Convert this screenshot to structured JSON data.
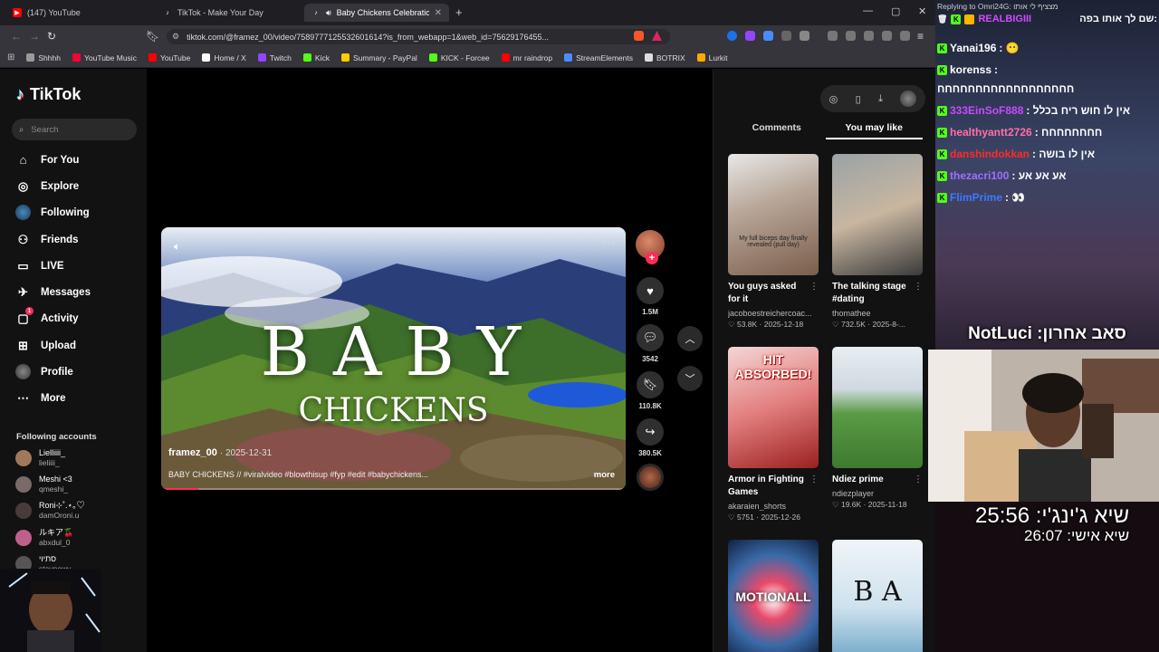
{
  "tabs": [
    {
      "title": "(147) YouTube",
      "favicon": "youtube-icon",
      "color": "#ff0000"
    },
    {
      "title": "TikTok - Make Your Day",
      "favicon": "tiktok-icon",
      "color": "#ffffff"
    },
    {
      "title": "Baby Chickens Celebration fo",
      "favicon": "tiktok-icon",
      "color": "#ffffff",
      "active": true
    }
  ],
  "address": {
    "url": "tiktok.com/@framez_00/video/7589777125532601614?is_from_webapp=1&web_id=75629176455..."
  },
  "bookmarks": [
    {
      "label": "Shhhh",
      "icon": "folder-icon",
      "color": "#999999"
    },
    {
      "label": "YouTube Music",
      "icon": "youtube-music-icon",
      "color": "#ff0033"
    },
    {
      "label": "YouTube",
      "icon": "youtube-icon",
      "color": "#ff0000"
    },
    {
      "label": "Home / X",
      "icon": "x-icon",
      "color": "#ffffff"
    },
    {
      "label": "Twitch",
      "icon": "twitch-icon",
      "color": "#9146ff"
    },
    {
      "label": "Kick",
      "icon": "kick-icon",
      "color": "#53fc18"
    },
    {
      "label": "Summary - PayPal",
      "icon": "paypal-icon",
      "color": "#ffcc00"
    },
    {
      "label": "KICK - Forcee",
      "icon": "kick-icon",
      "color": "#53fc18"
    },
    {
      "label": "mr raindrop",
      "icon": "youtube-icon",
      "color": "#ff0000"
    },
    {
      "label": "StreamElements",
      "icon": "streamelements-icon",
      "color": "#4a8cff"
    },
    {
      "label": "BOTRIX",
      "icon": "botrix-icon",
      "color": "#dddddd"
    },
    {
      "label": "Lurkit",
      "icon": "lurkit-icon",
      "color": "#ffaa00"
    }
  ],
  "tiktok": {
    "logo": "TikTok",
    "search_placeholder": "Search",
    "nav": [
      {
        "label": "For You",
        "icon": "home-icon",
        "glyph": "⌂"
      },
      {
        "label": "Explore",
        "icon": "compass-icon",
        "glyph": "◎"
      },
      {
        "label": "Following",
        "icon": "following-avatar-icon",
        "glyph": "●"
      },
      {
        "label": "Friends",
        "icon": "friends-icon",
        "glyph": "⚇"
      },
      {
        "label": "LIVE",
        "icon": "live-icon",
        "glyph": "▭"
      },
      {
        "label": "Messages",
        "icon": "messages-icon",
        "glyph": "✈"
      },
      {
        "label": "Activity",
        "icon": "activity-icon",
        "glyph": "▢",
        "badge": "1"
      },
      {
        "label": "Upload",
        "icon": "upload-icon",
        "glyph": "⊞"
      },
      {
        "label": "Profile",
        "icon": "profile-icon",
        "glyph": "●"
      },
      {
        "label": "More",
        "icon": "more-icon",
        "glyph": "⋯"
      }
    ],
    "following_header": "Following accounts",
    "following": [
      {
        "name": "Lielliiii_",
        "handle": "lieliiii_",
        "color": "#a0795a"
      },
      {
        "name": "Meshi <3",
        "handle": "qmeshi_",
        "color": "#7a6a6a"
      },
      {
        "name": "Roni⊹˚.⋆｡♡",
        "handle": "damOroni.u",
        "color": "#4a3b3b"
      },
      {
        "name": "ルキア🍒",
        "handle": "abxdul_0",
        "color": "#c0608a"
      },
      {
        "name": "סתיוי",
        "handle": "stavnewy",
        "color": "#555555"
      }
    ]
  },
  "video": {
    "title_big": "BABY",
    "title_small": "CHICKENS",
    "author": "framez_00",
    "date": "2025-12-31",
    "caption": "BABY CHICKENS // #viralvideo #blowthisup #fyp #edit #babychickens...",
    "more": "more",
    "progress": 0.08
  },
  "actions": {
    "likes": "1.5M",
    "comments": "3542",
    "saves": "110.8K",
    "shares": "380.5K"
  },
  "right_panel": {
    "tabs": [
      "Comments",
      "You may like"
    ],
    "active_tab": "You may like",
    "cards": [
      {
        "title": "You guys asked for it @ekkovision...",
        "user": "jacoboestreichercoac...",
        "stats": "♡ 53.8K · 2025-12-18",
        "thumb_text": "My full biceps day finally revealed (pull day)",
        "bg": "linear-gradient(160deg,#e8e8e8,#b9a89a 40%,#7b5d4c)"
      },
      {
        "title": "The talking stage #dating",
        "user": "thomathee",
        "stats": "♡ 732.5K · 2025-8-...",
        "thumb_text": "",
        "bg": "linear-gradient(160deg,#9aa3a6,#c8b6a0 50%,#3a3a3a)"
      },
      {
        "title": "Armor in Fighting Games Explained...",
        "user": "akaraien_shorts",
        "stats": "♡ 5751 · 2025-12-26",
        "thumb_text": "HIT ABSORBED!",
        "bg": "linear-gradient(160deg,#f4d6d6,#e27d7d 50%,#9a2020)"
      },
      {
        "title": "Ndiez prime",
        "user": "ndiezplayer",
        "stats": "♡ 19.6K · 2025-11-18",
        "thumb_text": "",
        "bg": "linear-gradient(180deg,#e8eef2 0%,#cfd9e0 35%,#5a9a45 55%,#3e7a30 100%)"
      },
      {
        "title": "",
        "user": "",
        "stats": "",
        "thumb_text": "MOTIONALL",
        "bg": "radial-gradient(circle at 50% 50%,#ffffff 0%,#e84a6a 25%,#3a6aa8 60%,#102040 100%)"
      },
      {
        "title": "",
        "user": "",
        "stats": "",
        "thumb_text": "B A",
        "bg": "linear-gradient(180deg,#f0f4f8 0%,#cfe2ee 55%,#6ea6c8 100%)"
      }
    ]
  },
  "chat": {
    "reply_header": "Replying to Omri24G: מצציף לי אותו",
    "top_line_user": "REALBIGIII",
    "top_line_text": "שם לך אותו בפה:",
    "lines": [
      {
        "user": "Yanai196",
        "text": ": 😶",
        "color": "#ffffff"
      },
      {
        "user": "korenss",
        "text": ":",
        "color": "#ffffff"
      },
      {
        "user": "",
        "text": "חחחחחחחחחחחחחחחחחח",
        "color": "#ffffff"
      },
      {
        "user": "333EinSoF888",
        "text": ": אין לו חוש ריח בכלל",
        "color": "#c84aff"
      },
      {
        "user": "healthyantt2726",
        "text": ": חחחחחחחח",
        "color": "#ff6fa8"
      },
      {
        "user": "danshindokkan",
        "text": ": אין לו בושה",
        "color": "#ff2a2a"
      },
      {
        "user": "thezacri100",
        "text": ": אע אע אע",
        "color": "#a070ff"
      },
      {
        "user": "FlimPrime",
        "text": ": 👀",
        "color": "#3a7aff"
      }
    ],
    "overlay_name": "NotLuci :סאב אחרון",
    "timer1": "שיא ג'ינג'י: 25:56",
    "timer2": "שיא אישי: 26:07"
  }
}
